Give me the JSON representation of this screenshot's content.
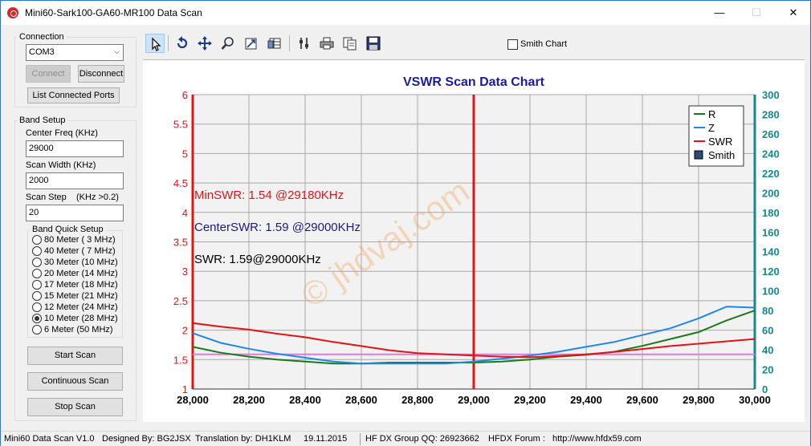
{
  "window": {
    "title": "Mini60-Sark100-GA60-MR100 Data Scan",
    "minimize": "—",
    "maximize": "☐",
    "close": "✕"
  },
  "connection": {
    "group_label": "Connection",
    "port_value": "COM3",
    "connect_label": "Connect",
    "disconnect_label": "Disconnect",
    "list_ports_label": "List Connected Ports"
  },
  "band_setup": {
    "group_label": "Band Setup",
    "center_freq_label": "Center Freq  (KHz)",
    "center_freq_value": "29000",
    "scan_width_label": "Scan Width   (KHz)",
    "scan_width_value": "2000",
    "scan_step_label": "Scan Step",
    "scan_step_hint": "(KHz >0.2)",
    "scan_step_value": "20",
    "quick_setup_label": "Band Quick Setup",
    "bands": [
      {
        "label": "80 Meter (  3 MHz)",
        "checked": false
      },
      {
        "label": "40 Meter (  7 MHz)",
        "checked": false
      },
      {
        "label": "30 Meter (10 MHz)",
        "checked": false
      },
      {
        "label": "20 Meter (14 MHz)",
        "checked": false
      },
      {
        "label": "17 Meter (18 MHz)",
        "checked": false
      },
      {
        "label": "15 Meter (21 MHz)",
        "checked": false
      },
      {
        "label": "12 Meter (24 MHz)",
        "checked": false
      },
      {
        "label": "10 Meter (28 MHz)",
        "checked": true
      },
      {
        "label": "6 Meter  (50 MHz)",
        "checked": false
      }
    ],
    "start_scan_label": "Start Scan",
    "continuous_scan_label": "Continuous Scan",
    "stop_scan_label": "Stop Scan"
  },
  "toolbar": {
    "icons": [
      "pointer-icon",
      "undo-icon",
      "pan-icon",
      "zoom-icon",
      "export-image-icon",
      "data-table-icon",
      "settings-icon",
      "print-icon",
      "copy-icon",
      "save-icon"
    ],
    "smith_chart_label": "Smith Chart",
    "smith_chart_checked": false
  },
  "watermark": "© jhdvaj.com",
  "chart_data": {
    "type": "line",
    "title": "VSWR Scan Data Chart",
    "x": [
      28000,
      28100,
      28200,
      28300,
      28400,
      28500,
      28600,
      28700,
      28800,
      28900,
      29000,
      29100,
      29200,
      29300,
      29400,
      29500,
      29600,
      29700,
      29800,
      29900,
      30000
    ],
    "x_ticks": [
      "28,000",
      "28,200",
      "28,400",
      "28,600",
      "28,800",
      "29,000",
      "29,200",
      "29,400",
      "29,600",
      "29,800",
      "30,000"
    ],
    "xlim": [
      28000,
      30000
    ],
    "ylim_left": [
      1,
      6
    ],
    "y_ticks_left": [
      "1",
      "1.5",
      "2",
      "2.5",
      "3",
      "3.5",
      "4",
      "4.5",
      "5",
      "5.5",
      "6"
    ],
    "ylim_right": [
      0,
      300
    ],
    "y_ticks_right": [
      "0",
      "20",
      "40",
      "60",
      "80",
      "100",
      "120",
      "140",
      "160",
      "180",
      "200",
      "220",
      "240",
      "260",
      "280",
      "300"
    ],
    "series": [
      {
        "name": "R",
        "axis": "right",
        "color": "#1a7a1a",
        "values": [
          43,
          37,
          33,
          30,
          28,
          26,
          26,
          27,
          27,
          27,
          27,
          28,
          30,
          33,
          35,
          38,
          44,
          51,
          58,
          70,
          80
        ]
      },
      {
        "name": "Z",
        "axis": "right",
        "color": "#1e88e5",
        "values": [
          57,
          47,
          41,
          36,
          32,
          28,
          26,
          26,
          26,
          26,
          28,
          31,
          34,
          38,
          43,
          48,
          55,
          62,
          72,
          84,
          83
        ]
      },
      {
        "name": "SWR",
        "axis": "left",
        "color": "#e11414",
        "values": [
          2.12,
          2.06,
          2.01,
          1.94,
          1.88,
          1.8,
          1.73,
          1.66,
          1.61,
          1.59,
          1.57,
          1.55,
          1.54,
          1.56,
          1.59,
          1.63,
          1.68,
          1.73,
          1.77,
          1.81,
          1.85
        ]
      }
    ],
    "center_freq": 29000,
    "threshold_swr": 1.59,
    "legend": [
      "R",
      "Z",
      "SWR",
      "Smith"
    ],
    "legend_position": "top-right",
    "annotations": {
      "min_swr": "MinSWR: 1.54 @29180KHz",
      "center_swr": "CenterSWR: 1.59 @29000KHz",
      "swr": "SWR: 1.59@29000KHz"
    },
    "colors": {
      "left_axis": "#e11414",
      "right_axis": "#138a8a",
      "title": "#1a1aa6",
      "center_line": "#e11414",
      "threshold_line": "#e07ae0",
      "grid": "#a8a8a8",
      "plot_bg": "#f2f2f2",
      "center_swr_text": "#1a1a80"
    },
    "grid": true
  },
  "status": {
    "version": "Mini60 Data Scan V1.0",
    "designer": "Designed By: BG2JSX",
    "translator": "Translation by: DH1KLM",
    "date": "19.11.2015",
    "group": "HF DX Group QQ: 26923662",
    "forum": "HFDX Forum :",
    "url": "http://www.hfdx59.com"
  }
}
